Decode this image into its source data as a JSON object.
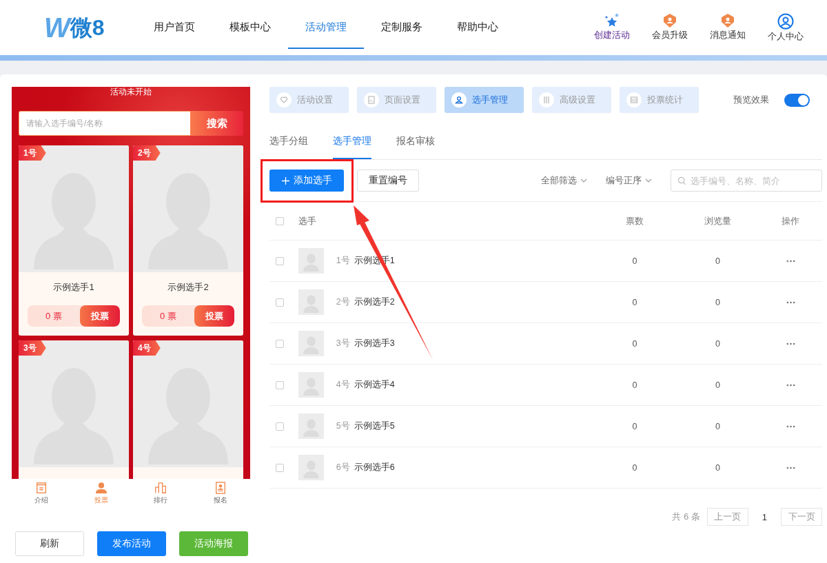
{
  "header": {
    "logo": {
      "mark": "W",
      "name": "微8"
    },
    "nav": [
      {
        "label": "用户首页",
        "selected": false
      },
      {
        "label": "模板中心",
        "selected": false
      },
      {
        "label": "活动管理",
        "selected": true
      },
      {
        "label": "定制服务",
        "selected": false
      },
      {
        "label": "帮助中心",
        "selected": false
      }
    ],
    "actions": [
      {
        "label": "创建活动",
        "kind": "create"
      },
      {
        "label": "会员升级",
        "kind": "badge"
      },
      {
        "label": "消息通知",
        "kind": "badge"
      },
      {
        "label": "个人中心",
        "kind": "user"
      }
    ]
  },
  "preview": {
    "status": "活动未开始",
    "search_placeholder": "请输入选手编号/名称",
    "search_button": "搜索",
    "contestants": [
      {
        "badge": "1号",
        "name": "示例选手1",
        "votes": "0 票",
        "vote_button": "投票"
      },
      {
        "badge": "2号",
        "name": "示例选手2",
        "votes": "0 票",
        "vote_button": "投票"
      },
      {
        "badge": "3号"
      },
      {
        "badge": "4号"
      }
    ],
    "bottom_nav": [
      {
        "label": "介绍",
        "kind": "intro",
        "selected": false
      },
      {
        "label": "投票",
        "kind": "vote",
        "selected": true
      },
      {
        "label": "排行",
        "kind": "rank",
        "selected": false
      },
      {
        "label": "报名",
        "kind": "signup",
        "selected": false
      }
    ]
  },
  "preview_buttons": [
    {
      "label": "刷新",
      "kind": "default"
    },
    {
      "label": "发布活动",
      "kind": "primary"
    },
    {
      "label": "活动海报",
      "kind": "success"
    }
  ],
  "settings_tabs": [
    {
      "label": "活动设置",
      "kind": "heart",
      "selected": false
    },
    {
      "label": "页面设置",
      "kind": "page",
      "selected": false
    },
    {
      "label": "选手管理",
      "kind": "user",
      "selected": true
    },
    {
      "label": "高级设置",
      "kind": "tools",
      "selected": false
    },
    {
      "label": "投票统计",
      "kind": "stats",
      "selected": false
    }
  ],
  "preview_toggle": {
    "label": "预览效果",
    "on": true
  },
  "sub_tabs": [
    {
      "label": "选手分组",
      "selected": false
    },
    {
      "label": "选手管理",
      "selected": true
    },
    {
      "label": "报名审核",
      "selected": false
    }
  ],
  "toolbar": {
    "add_button": "添加选手",
    "reset_button": "重置编号",
    "filters": [
      {
        "label": "全部筛选"
      },
      {
        "label": "编号正序"
      }
    ],
    "search_placeholder": "选手编号、名称、简介"
  },
  "table": {
    "columns": [
      "选手",
      "票数",
      "浏览量",
      "操作"
    ],
    "all_checked": false,
    "rows": [
      {
        "number": "1号",
        "name": "示例选手1",
        "votes": "0",
        "views": "0",
        "checked": false
      },
      {
        "number": "2号",
        "name": "示例选手2",
        "votes": "0",
        "views": "0",
        "checked": false
      },
      {
        "number": "3号",
        "name": "示例选手3",
        "votes": "0",
        "views": "0",
        "checked": false
      },
      {
        "number": "4号",
        "name": "示例选手4",
        "votes": "0",
        "views": "0",
        "checked": false
      },
      {
        "number": "5号",
        "name": "示例选手5",
        "votes": "0",
        "views": "0",
        "checked": false
      },
      {
        "number": "6号",
        "name": "示例选手6",
        "votes": "0",
        "views": "0",
        "checked": false
      }
    ]
  },
  "pagination": {
    "total": "共 6 条",
    "prev": "上一页",
    "page": "1",
    "next": "下一页"
  },
  "annotation": {
    "highlight": true,
    "arrow": true
  }
}
